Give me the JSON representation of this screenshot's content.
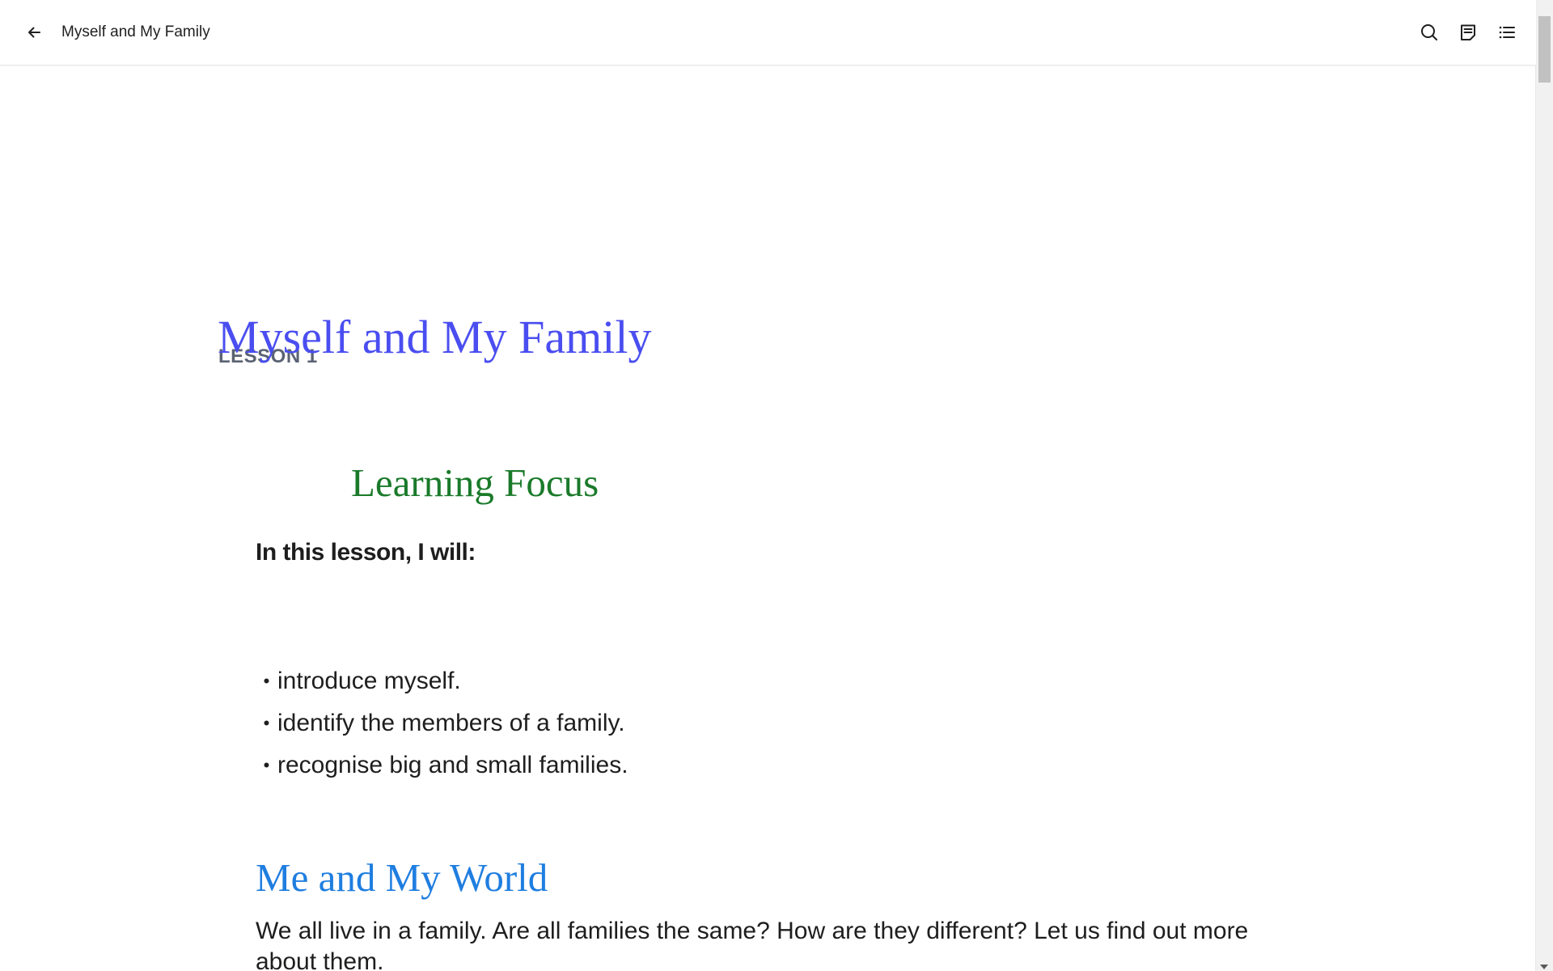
{
  "topbar": {
    "title": "Myself and My Family",
    "back_icon": "arrow-left-icon",
    "actions": [
      {
        "name": "search",
        "icon": "search-icon"
      },
      {
        "name": "notes",
        "icon": "notes-icon"
      },
      {
        "name": "contents",
        "icon": "list-icon"
      }
    ]
  },
  "lesson": {
    "label": "LESSON 1",
    "title": "Myself and My Family",
    "title_color": "#4a4ef0"
  },
  "learning_focus": {
    "heading": "Learning Focus",
    "heading_color": "#1a7a2a",
    "intro": "In this lesson, I will:",
    "items": [
      "introduce myself.",
      "identify the members of a family.",
      "recognise big and small families."
    ]
  },
  "section": {
    "heading": "Me and My World",
    "heading_color": "#1f7ee0",
    "body": "We all live in a family. Are all families the same? How are they different? Let us find out more about them."
  }
}
